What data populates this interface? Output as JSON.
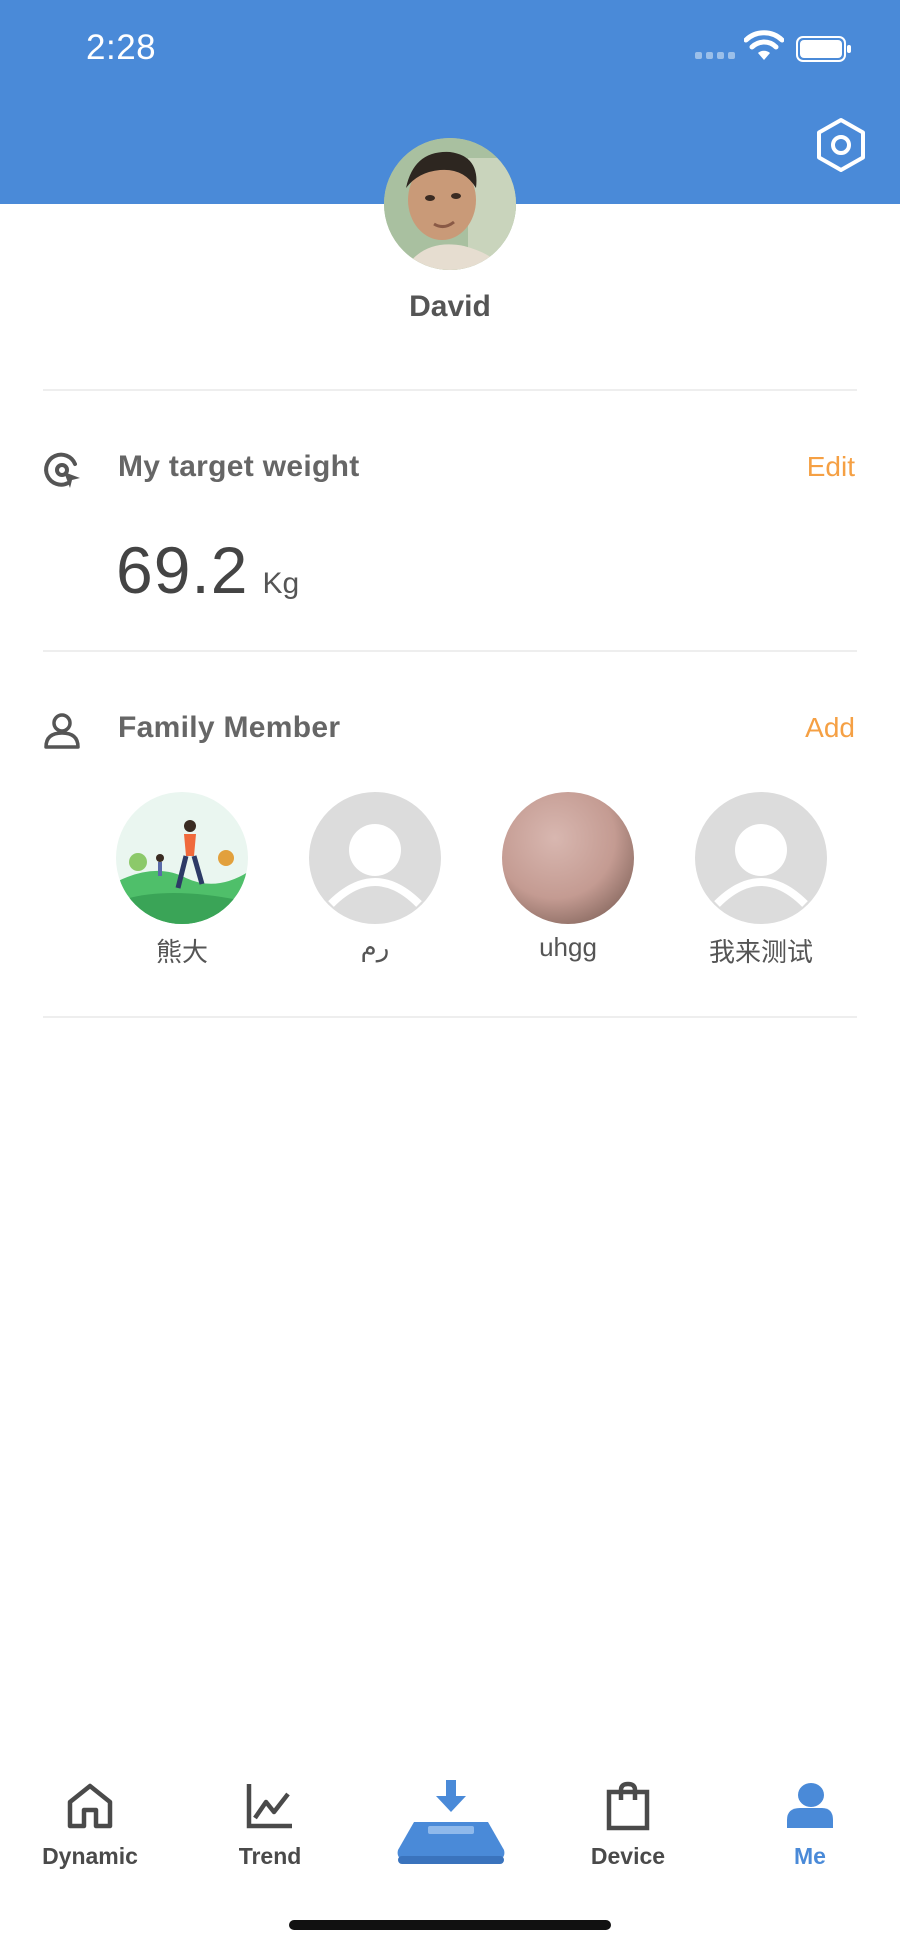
{
  "status_bar": {
    "time": "2:28"
  },
  "colors": {
    "primary": "#4a8ad8",
    "accent": "#f5a044",
    "text": "#555555"
  },
  "profile": {
    "name": "David",
    "settings_icon": "gear-icon"
  },
  "target_weight": {
    "title": "My target weight",
    "action": "Edit",
    "value": "69.2",
    "unit": "Kg"
  },
  "family": {
    "title": "Family Member",
    "action": "Add",
    "members": [
      {
        "name": "熊大"
      },
      {
        "name": "رم"
      },
      {
        "name": "uhgg"
      },
      {
        "name": "我来测试"
      }
    ]
  },
  "tabs": [
    {
      "label": "Dynamic",
      "icon": "home-icon"
    },
    {
      "label": "Trend",
      "icon": "trend-chart-icon"
    },
    {
      "label": "",
      "icon": "scale-download-icon"
    },
    {
      "label": "Device",
      "icon": "shopping-bag-icon"
    },
    {
      "label": "Me",
      "icon": "person-icon",
      "active": true
    }
  ]
}
